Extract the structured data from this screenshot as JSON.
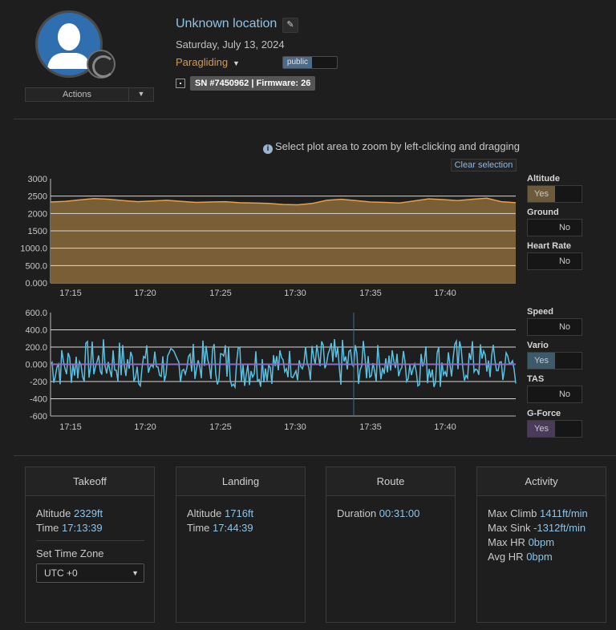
{
  "header": {
    "location_title": "Unknown location",
    "date": "Saturday, July 13, 2024",
    "activity_type": "Paragliding",
    "privacy_label": "public",
    "actions_label": "Actions",
    "device_badge": "SN #7450962 | Firmware: 26"
  },
  "plot": {
    "hint": "Select plot area to zoom by left-clicking and dragging",
    "clear_selection_label": "Clear selection"
  },
  "toggles": [
    {
      "label": "Altitude",
      "state": "Yes"
    },
    {
      "label": "Ground",
      "state": "No"
    },
    {
      "label": "Heart Rate",
      "state": "No"
    },
    {
      "label": "Speed",
      "state": "No"
    },
    {
      "label": "Vario",
      "state": "Yes"
    },
    {
      "label": "TAS",
      "state": "No"
    },
    {
      "label": "G-Force",
      "state": "Yes"
    }
  ],
  "colors": {
    "altitude_line": "#e8a04a",
    "altitude_fill": "#7a5e35",
    "vario_line": "#5bc0e0",
    "vario_zero_line": "#8a6cc0",
    "link_blue": "#8fc3e6"
  },
  "chart_data": [
    {
      "type": "area",
      "name": "altitude",
      "x": [
        "17:13:39",
        "17:14",
        "17:15",
        "17:16",
        "17:17",
        "17:18",
        "17:19",
        "17:20",
        "17:21",
        "17:22",
        "17:23",
        "17:24",
        "17:25",
        "17:26",
        "17:27",
        "17:28",
        "17:29",
        "17:30",
        "17:31",
        "17:32",
        "17:33",
        "17:34",
        "17:35",
        "17:36",
        "17:37",
        "17:38",
        "17:39",
        "17:40",
        "17:41",
        "17:42",
        "17:43",
        "17:44",
        "17:44:39"
      ],
      "series": [
        {
          "values": [
            2330,
            2350,
            2390,
            2430,
            2410,
            2370,
            2340,
            2360,
            2380,
            2350,
            2320,
            2330,
            2340,
            2310,
            2300,
            2290,
            2260,
            2250,
            2290,
            2380,
            2410,
            2370,
            2330,
            2320,
            2300,
            2360,
            2420,
            2400,
            2370,
            2410,
            2440,
            2340,
            2310
          ]
        }
      ],
      "x_ticks": [
        "17:15",
        "17:20",
        "17:25",
        "17:30",
        "17:35",
        "17:40"
      ],
      "y_ticks": [
        "3000",
        "2500",
        "2000",
        "1500",
        "1000.0",
        "500.0",
        "0.000"
      ],
      "ylim": [
        0,
        3000
      ],
      "grid": true
    },
    {
      "type": "line",
      "name": "vario",
      "x_ticks": [
        "17:15",
        "17:20",
        "17:25",
        "17:30",
        "17:35",
        "17:40"
      ],
      "y_ticks": [
        "600.0",
        "400.0",
        "200.0",
        "0.000",
        "-200",
        "-400",
        "-600"
      ],
      "ylim": [
        -600,
        600
      ],
      "grid": true
    }
  ],
  "cards": {
    "takeoff": {
      "title": "Takeoff",
      "altitude_label": "Altitude",
      "altitude_value": "2329ft",
      "time_label": "Time",
      "time_value": "17:13:39",
      "tz_label": "Set Time Zone",
      "tz_value": "UTC +0"
    },
    "landing": {
      "title": "Landing",
      "altitude_label": "Altitude",
      "altitude_value": "1716ft",
      "time_label": "Time",
      "time_value": "17:44:39"
    },
    "route": {
      "title": "Route",
      "duration_label": "Duration",
      "duration_value": "00:31:00"
    },
    "activity": {
      "title": "Activity",
      "max_climb_label": "Max Climb",
      "max_climb_value": "1411ft/min",
      "max_sink_label": "Max Sink",
      "max_sink_value": "-1312ft/min",
      "max_hr_label": "Max HR",
      "max_hr_value": "0bpm",
      "avg_hr_label": "Avg HR",
      "avg_hr_value": "0bpm"
    }
  }
}
